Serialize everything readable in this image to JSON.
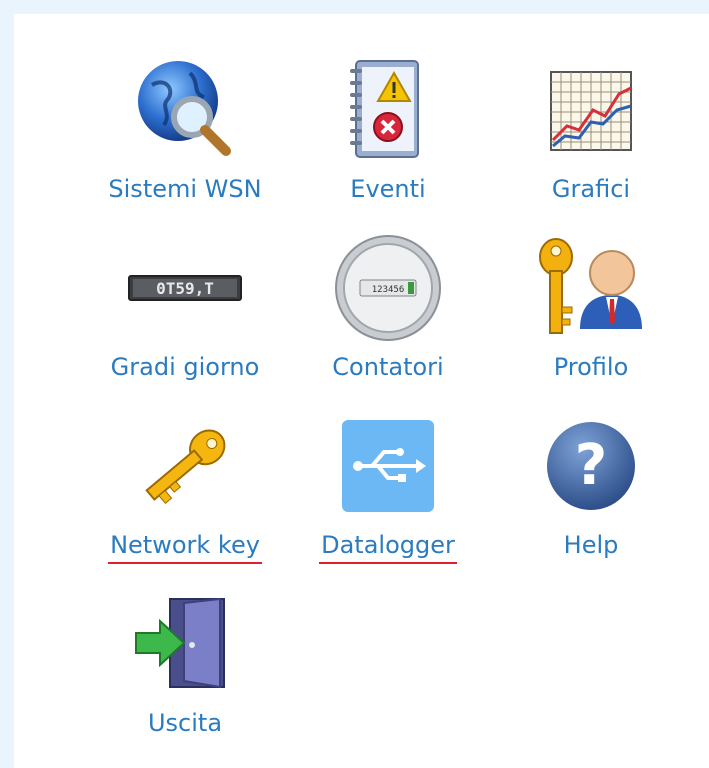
{
  "menu": {
    "items": [
      {
        "id": "sistemi-wsn",
        "label": "Sistemi WSN",
        "icon": "globe-search-icon"
      },
      {
        "id": "eventi",
        "label": "Eventi",
        "icon": "event-log-notebook-icon"
      },
      {
        "id": "grafici",
        "label": "Grafici",
        "icon": "line-chart-icon"
      },
      {
        "id": "gradi-giorno",
        "label": "Gradi giorno",
        "icon": "digital-counter-icon"
      },
      {
        "id": "contatori",
        "label": "Contatori",
        "icon": "meter-dial-icon"
      },
      {
        "id": "profilo",
        "label": "Profilo",
        "icon": "user-key-icon"
      },
      {
        "id": "network-key",
        "label": "Network key",
        "icon": "golden-key-icon"
      },
      {
        "id": "datalogger",
        "label": "Datalogger",
        "icon": "usb-icon"
      },
      {
        "id": "help",
        "label": "Help",
        "icon": "help-question-icon"
      },
      {
        "id": "uscita",
        "label": "Uscita",
        "icon": "exit-door-icon"
      }
    ],
    "counter_display": "0T59,T",
    "meter_display": "123456"
  },
  "colors": {
    "label": "#2a7bbf",
    "underline": "#e0202a",
    "background": "#eaf4fd"
  }
}
